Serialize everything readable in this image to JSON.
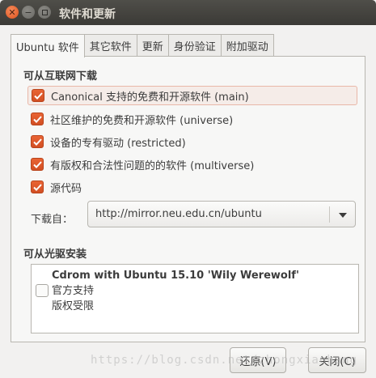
{
  "window": {
    "title": "软件和更新"
  },
  "tabs": [
    {
      "label": "Ubuntu 软件"
    },
    {
      "label": "其它软件"
    },
    {
      "label": "更新"
    },
    {
      "label": "身份验证"
    },
    {
      "label": "附加驱动"
    }
  ],
  "internet": {
    "heading": "可从互联网下载",
    "options": [
      {
        "label": "Canonical 支持的免费和开源软件 (main)",
        "checked": true
      },
      {
        "label": "社区维护的免费和开源软件 (universe)",
        "checked": true
      },
      {
        "label": "设备的专有驱动 (restricted)",
        "checked": true
      },
      {
        "label": "有版权和合法性问题的的软件 (multiverse)",
        "checked": true
      },
      {
        "label": "源代码",
        "checked": true
      }
    ],
    "download_from_label": "下载自：",
    "download_from_value": "http://mirror.neu.edu.cn/ubuntu"
  },
  "cdrom": {
    "heading": "可从光驱安装",
    "item": {
      "name": "Cdrom with Ubuntu 15.10 'Wily Werewolf'",
      "line2": "官方支持",
      "line3": "版权受限",
      "checked": false
    }
  },
  "buttons": {
    "revert": "还原(V)",
    "close": "关闭(C)"
  },
  "watermark": "https://blog.csdn.net/zhongxiaohang",
  "colors": {
    "accent": "#e0531e",
    "titlebar": "#3b3a36",
    "highlight": "#f5ece8"
  }
}
